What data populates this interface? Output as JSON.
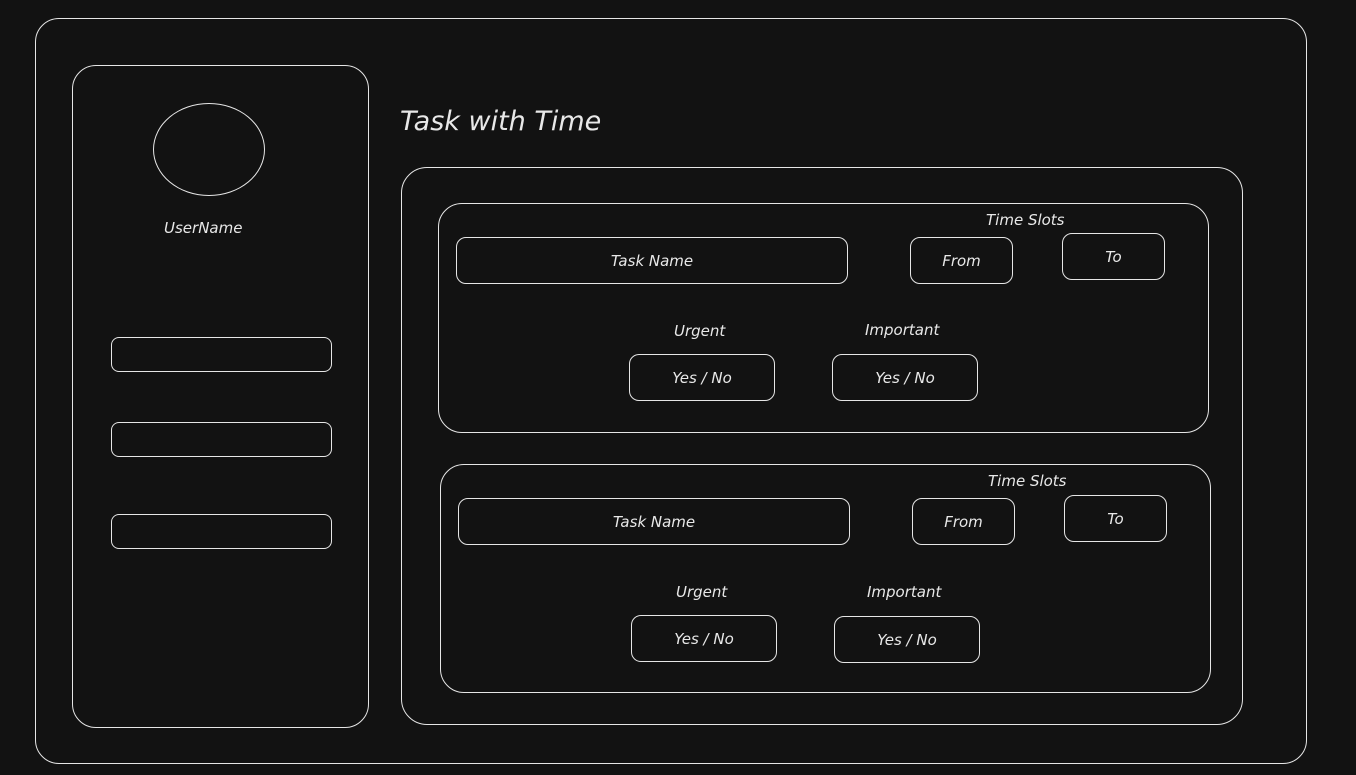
{
  "header": {
    "title": "Task with Time"
  },
  "sidebar": {
    "username": "UserName",
    "nav_items": [
      "",
      "",
      ""
    ]
  },
  "tasks": [
    {
      "task_name_placeholder": "Task Name",
      "time_slots_label": "Time Slots",
      "from_label": "From",
      "to_label": "To",
      "urgent_label": "Urgent",
      "urgent_value": "Yes / No",
      "important_label": "Important",
      "important_value": "Yes / No"
    },
    {
      "task_name_placeholder": "Task Name",
      "time_slots_label": "Time Slots",
      "from_label": "From",
      "to_label": "To",
      "urgent_label": "Urgent",
      "urgent_value": "Yes / No",
      "important_label": "Important",
      "important_value": "Yes / No"
    }
  ],
  "colors": {
    "background": "#121212",
    "stroke": "#e6e6e6",
    "text": "#e8e8e8"
  }
}
